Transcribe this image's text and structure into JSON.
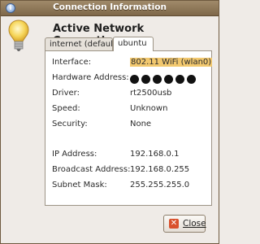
{
  "window": {
    "title": "Connection Information",
    "heading": "Active Network Connections"
  },
  "tabs": [
    {
      "label": "internet (default)",
      "active": false
    },
    {
      "label": "ubuntu",
      "active": true
    }
  ],
  "info": {
    "interface": {
      "label": "Interface:",
      "value": "802.11 WiFi (wlan0)"
    },
    "hardware": {
      "label": "Hardware Address:",
      "value": "●●●●●●"
    },
    "driver": {
      "label": "Driver:",
      "value": "rt2500usb"
    },
    "speed": {
      "label": "Speed:",
      "value": "Unknown"
    },
    "security": {
      "label": "Security:",
      "value": "None"
    },
    "ip": {
      "label": "IP Address:",
      "value": "192.168.0.1"
    },
    "broadcast": {
      "label": "Broadcast Address:",
      "value": "192.168.0.255"
    },
    "subnet": {
      "label": "Subnet Mask:",
      "value": "255.255.255.0"
    }
  },
  "buttons": {
    "close": "Close"
  },
  "icons": {
    "title_icon": "info-icon",
    "hero_icon": "lightbulb-icon",
    "close_icon": "close-icon"
  },
  "colors": {
    "titlebar": "#8d7656",
    "highlight": "#f2c86e"
  }
}
